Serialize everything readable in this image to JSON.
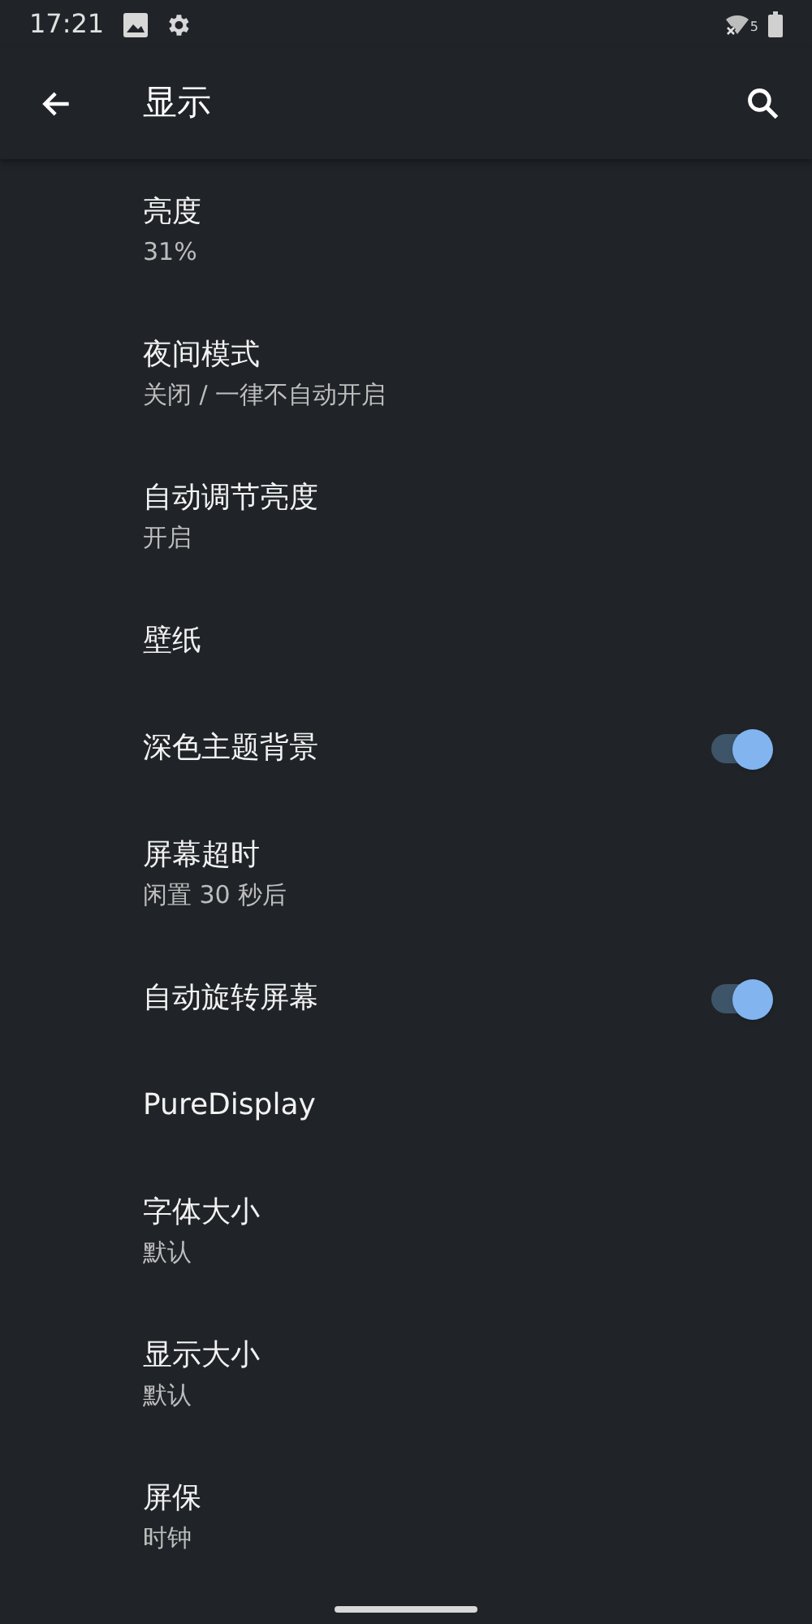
{
  "status_bar": {
    "time": "17:21",
    "network_label": "5"
  },
  "app_bar": {
    "title": "显示"
  },
  "settings": [
    {
      "kind": "summary",
      "title": "亮度",
      "summary": "31%"
    },
    {
      "kind": "summary",
      "title": "夜间模式",
      "summary": "关闭 / 一律不自动开启"
    },
    {
      "kind": "summary",
      "title": "自动调节亮度",
      "summary": "开启"
    },
    {
      "kind": "plain",
      "title": "壁纸"
    },
    {
      "kind": "switch",
      "title": "深色主题背景",
      "on": true
    },
    {
      "kind": "summary",
      "title": "屏幕超时",
      "summary": "闲置 30 秒后"
    },
    {
      "kind": "switch",
      "title": "自动旋转屏幕",
      "on": true
    },
    {
      "kind": "plain",
      "title": "PureDisplay"
    },
    {
      "kind": "summary",
      "title": "字体大小",
      "summary": "默认"
    },
    {
      "kind": "summary",
      "title": "显示大小",
      "summary": "默认"
    },
    {
      "kind": "summary",
      "title": "屏保",
      "summary": "时钟"
    }
  ]
}
